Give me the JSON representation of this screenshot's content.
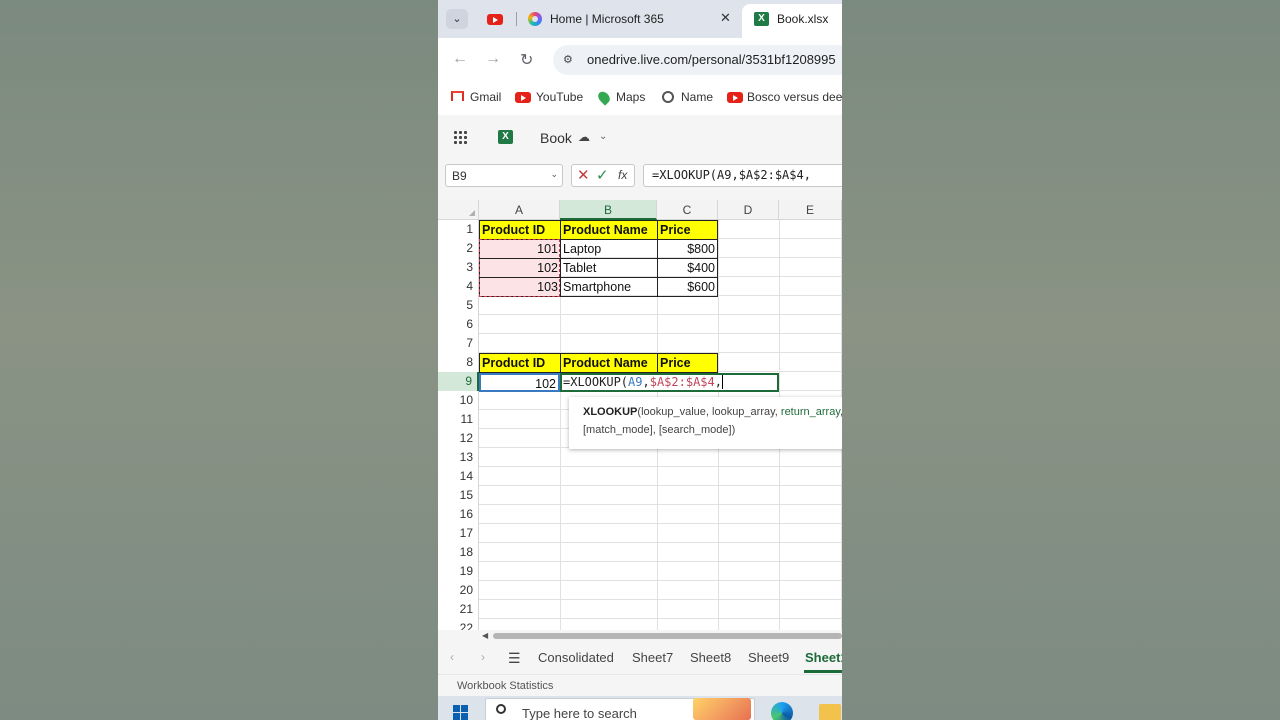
{
  "browser": {
    "tabs": [
      {
        "label": "Home | Microsoft 365"
      },
      {
        "label": "Book.xlsx"
      }
    ],
    "url": "onedrive.live.com/personal/3531bf1208995",
    "bookmarks": [
      "Gmail",
      "YouTube",
      "Maps",
      "Name",
      "Bosco versus deer"
    ]
  },
  "excel": {
    "doc_title": "Book",
    "name_box": "B9",
    "formula_bar": "=XLOOKUP(A9,$A$2:$A$4,",
    "columns": [
      "A",
      "B",
      "C",
      "D",
      "E"
    ],
    "rows": [
      "1",
      "2",
      "3",
      "4",
      "5",
      "6",
      "7",
      "8",
      "9",
      "10",
      "11",
      "12",
      "13",
      "14",
      "15",
      "16",
      "17",
      "18",
      "19",
      "20",
      "21",
      "22"
    ],
    "table1": {
      "headers": [
        "Product ID",
        "Product Name",
        "Price"
      ],
      "rows": [
        [
          "101",
          "Laptop",
          "$800"
        ],
        [
          "102",
          "Tablet",
          "$400"
        ],
        [
          "103",
          "Smartphone",
          "$600"
        ]
      ]
    },
    "table2": {
      "headers": [
        "Product ID",
        "Product Name",
        "Price"
      ],
      "id_value": "102",
      "edit": {
        "fn": "=XLOOKUP(",
        "arg1": "A9",
        "sep1": ",",
        "arg2": "$A$2:$A$4",
        "sep2": ","
      }
    },
    "tooltip": {
      "fn": "XLOOKUP",
      "args_before": "(lookup_value, lookup_array, ",
      "active_arg": "return_array",
      "tail": ",",
      "line2": "[match_mode], [search_mode])"
    },
    "sheet_tabs": [
      "Consolidated",
      "Sheet7",
      "Sheet8",
      "Sheet9",
      "Sheet1"
    ],
    "active_sheet": "Sheet1",
    "status": "Workbook Statistics"
  },
  "taskbar": {
    "search_placeholder": "Type here to search"
  }
}
